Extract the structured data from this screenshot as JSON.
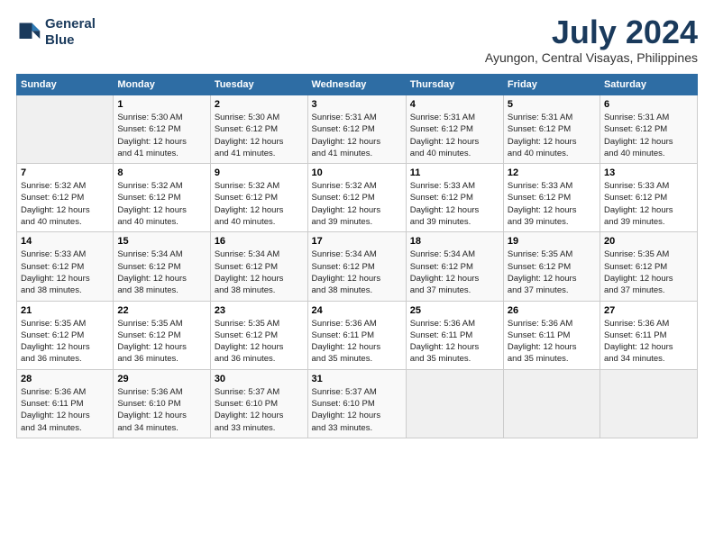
{
  "logo": {
    "line1": "General",
    "line2": "Blue"
  },
  "title": "July 2024",
  "subtitle": "Ayungon, Central Visayas, Philippines",
  "days_header": [
    "Sunday",
    "Monday",
    "Tuesday",
    "Wednesday",
    "Thursday",
    "Friday",
    "Saturday"
  ],
  "weeks": [
    [
      {
        "num": "",
        "info": ""
      },
      {
        "num": "1",
        "info": "Sunrise: 5:30 AM\nSunset: 6:12 PM\nDaylight: 12 hours\nand 41 minutes."
      },
      {
        "num": "2",
        "info": "Sunrise: 5:30 AM\nSunset: 6:12 PM\nDaylight: 12 hours\nand 41 minutes."
      },
      {
        "num": "3",
        "info": "Sunrise: 5:31 AM\nSunset: 6:12 PM\nDaylight: 12 hours\nand 41 minutes."
      },
      {
        "num": "4",
        "info": "Sunrise: 5:31 AM\nSunset: 6:12 PM\nDaylight: 12 hours\nand 40 minutes."
      },
      {
        "num": "5",
        "info": "Sunrise: 5:31 AM\nSunset: 6:12 PM\nDaylight: 12 hours\nand 40 minutes."
      },
      {
        "num": "6",
        "info": "Sunrise: 5:31 AM\nSunset: 6:12 PM\nDaylight: 12 hours\nand 40 minutes."
      }
    ],
    [
      {
        "num": "7",
        "info": "Sunrise: 5:32 AM\nSunset: 6:12 PM\nDaylight: 12 hours\nand 40 minutes."
      },
      {
        "num": "8",
        "info": "Sunrise: 5:32 AM\nSunset: 6:12 PM\nDaylight: 12 hours\nand 40 minutes."
      },
      {
        "num": "9",
        "info": "Sunrise: 5:32 AM\nSunset: 6:12 PM\nDaylight: 12 hours\nand 40 minutes."
      },
      {
        "num": "10",
        "info": "Sunrise: 5:32 AM\nSunset: 6:12 PM\nDaylight: 12 hours\nand 39 minutes."
      },
      {
        "num": "11",
        "info": "Sunrise: 5:33 AM\nSunset: 6:12 PM\nDaylight: 12 hours\nand 39 minutes."
      },
      {
        "num": "12",
        "info": "Sunrise: 5:33 AM\nSunset: 6:12 PM\nDaylight: 12 hours\nand 39 minutes."
      },
      {
        "num": "13",
        "info": "Sunrise: 5:33 AM\nSunset: 6:12 PM\nDaylight: 12 hours\nand 39 minutes."
      }
    ],
    [
      {
        "num": "14",
        "info": "Sunrise: 5:33 AM\nSunset: 6:12 PM\nDaylight: 12 hours\nand 38 minutes."
      },
      {
        "num": "15",
        "info": "Sunrise: 5:34 AM\nSunset: 6:12 PM\nDaylight: 12 hours\nand 38 minutes."
      },
      {
        "num": "16",
        "info": "Sunrise: 5:34 AM\nSunset: 6:12 PM\nDaylight: 12 hours\nand 38 minutes."
      },
      {
        "num": "17",
        "info": "Sunrise: 5:34 AM\nSunset: 6:12 PM\nDaylight: 12 hours\nand 38 minutes."
      },
      {
        "num": "18",
        "info": "Sunrise: 5:34 AM\nSunset: 6:12 PM\nDaylight: 12 hours\nand 37 minutes."
      },
      {
        "num": "19",
        "info": "Sunrise: 5:35 AM\nSunset: 6:12 PM\nDaylight: 12 hours\nand 37 minutes."
      },
      {
        "num": "20",
        "info": "Sunrise: 5:35 AM\nSunset: 6:12 PM\nDaylight: 12 hours\nand 37 minutes."
      }
    ],
    [
      {
        "num": "21",
        "info": "Sunrise: 5:35 AM\nSunset: 6:12 PM\nDaylight: 12 hours\nand 36 minutes."
      },
      {
        "num": "22",
        "info": "Sunrise: 5:35 AM\nSunset: 6:12 PM\nDaylight: 12 hours\nand 36 minutes."
      },
      {
        "num": "23",
        "info": "Sunrise: 5:35 AM\nSunset: 6:12 PM\nDaylight: 12 hours\nand 36 minutes."
      },
      {
        "num": "24",
        "info": "Sunrise: 5:36 AM\nSunset: 6:11 PM\nDaylight: 12 hours\nand 35 minutes."
      },
      {
        "num": "25",
        "info": "Sunrise: 5:36 AM\nSunset: 6:11 PM\nDaylight: 12 hours\nand 35 minutes."
      },
      {
        "num": "26",
        "info": "Sunrise: 5:36 AM\nSunset: 6:11 PM\nDaylight: 12 hours\nand 35 minutes."
      },
      {
        "num": "27",
        "info": "Sunrise: 5:36 AM\nSunset: 6:11 PM\nDaylight: 12 hours\nand 34 minutes."
      }
    ],
    [
      {
        "num": "28",
        "info": "Sunrise: 5:36 AM\nSunset: 6:11 PM\nDaylight: 12 hours\nand 34 minutes."
      },
      {
        "num": "29",
        "info": "Sunrise: 5:36 AM\nSunset: 6:10 PM\nDaylight: 12 hours\nand 34 minutes."
      },
      {
        "num": "30",
        "info": "Sunrise: 5:37 AM\nSunset: 6:10 PM\nDaylight: 12 hours\nand 33 minutes."
      },
      {
        "num": "31",
        "info": "Sunrise: 5:37 AM\nSunset: 6:10 PM\nDaylight: 12 hours\nand 33 minutes."
      },
      {
        "num": "",
        "info": ""
      },
      {
        "num": "",
        "info": ""
      },
      {
        "num": "",
        "info": ""
      }
    ]
  ]
}
